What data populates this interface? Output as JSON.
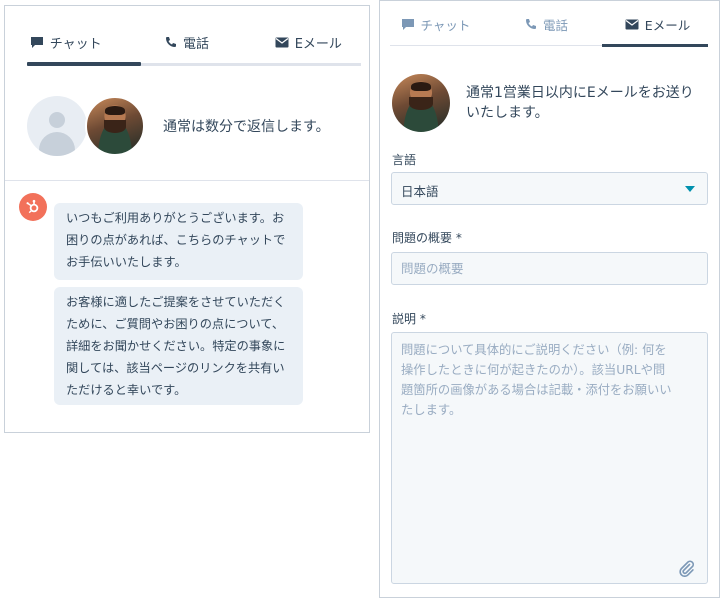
{
  "chat_panel": {
    "tabs": [
      {
        "label": "チャット",
        "icon": "chat-bubble-icon",
        "active": true
      },
      {
        "label": "電話",
        "icon": "phone-icon",
        "active": false
      },
      {
        "label": "Eメール",
        "icon": "envelope-icon",
        "active": false
      }
    ],
    "welcome_text": "通常は数分で返信します。",
    "messages": [
      {
        "lines": [
          "いつもご利用ありがとうございます。お",
          "困りの点があれば、こちらのチャットで",
          "お手伝いいたします。"
        ]
      },
      {
        "lines": [
          "お客様に適したご提案をさせていただく",
          "ために、ご質問やお困りの点について、",
          "詳細をお聞かせください。特定の事象に",
          "関しては、該当ページのリンクを共有い",
          "ただけると幸いです。"
        ]
      }
    ]
  },
  "email_panel": {
    "tabs": [
      {
        "label": "チャット",
        "icon": "chat-bubble-icon",
        "active": false
      },
      {
        "label": "電話",
        "icon": "phone-icon",
        "active": false
      },
      {
        "label": "Eメール",
        "icon": "envelope-icon",
        "active": true
      }
    ],
    "intro_lines": [
      "通常1営業日以内にEメールをお送り",
      "いたします。"
    ],
    "language": {
      "label": "言語",
      "value": "日本語"
    },
    "subject": {
      "label": "問題の概要 *",
      "placeholder": "問題の概要",
      "value": ""
    },
    "description": {
      "label": "説明 *",
      "placeholder_lines": [
        "問題について具体的にご説明ください（例: 何を",
        "操作したときに何が起きたのか）。該当URLや問",
        "題箇所の画像がある場合は記載・添付をお願いい",
        "たします。"
      ]
    }
  },
  "colors": {
    "text": "#33475b",
    "muted": "#7c98b6",
    "bubble": "#eaf0f6",
    "field_bg": "#f5f8fa",
    "accent": "#0091ae",
    "bot_badge": "#f2715a"
  }
}
